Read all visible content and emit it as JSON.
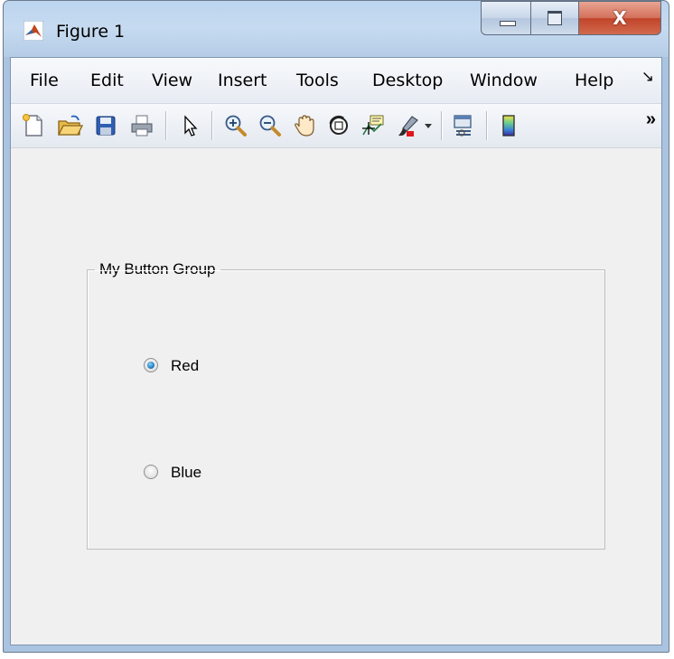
{
  "window": {
    "title": "Figure 1",
    "controls": {
      "minimize": "minimize",
      "maximize": "maximize",
      "close": "X"
    }
  },
  "menubar": {
    "items": [
      "File",
      "Edit",
      "View",
      "Insert",
      "Tools",
      "Desktop",
      "Window",
      "Help"
    ],
    "overflow": "↘"
  },
  "toolbar": {
    "buttons": [
      {
        "icon": "new-figure-icon"
      },
      {
        "icon": "open-file-icon"
      },
      {
        "icon": "save-figure-icon"
      },
      {
        "icon": "print-figure-icon"
      },
      {
        "icon": "edit-plot-icon"
      },
      {
        "icon": "zoom-in-icon"
      },
      {
        "icon": "zoom-out-icon"
      },
      {
        "icon": "pan-icon"
      },
      {
        "icon": "rotate-3d-icon"
      },
      {
        "icon": "data-cursor-icon"
      },
      {
        "icon": "brush-icon"
      },
      {
        "icon": "link-plot-icon"
      },
      {
        "icon": "insert-colorbar-icon"
      }
    ],
    "overflow": "»"
  },
  "button_group": {
    "title": "My Button Group",
    "options": [
      {
        "label": "Red",
        "selected": true
      },
      {
        "label": "Blue",
        "selected": false
      }
    ]
  },
  "colors": {
    "selected_radio": "#2e8fd0",
    "close_button": "#c1442a",
    "client_background": "#f0f0f0"
  }
}
